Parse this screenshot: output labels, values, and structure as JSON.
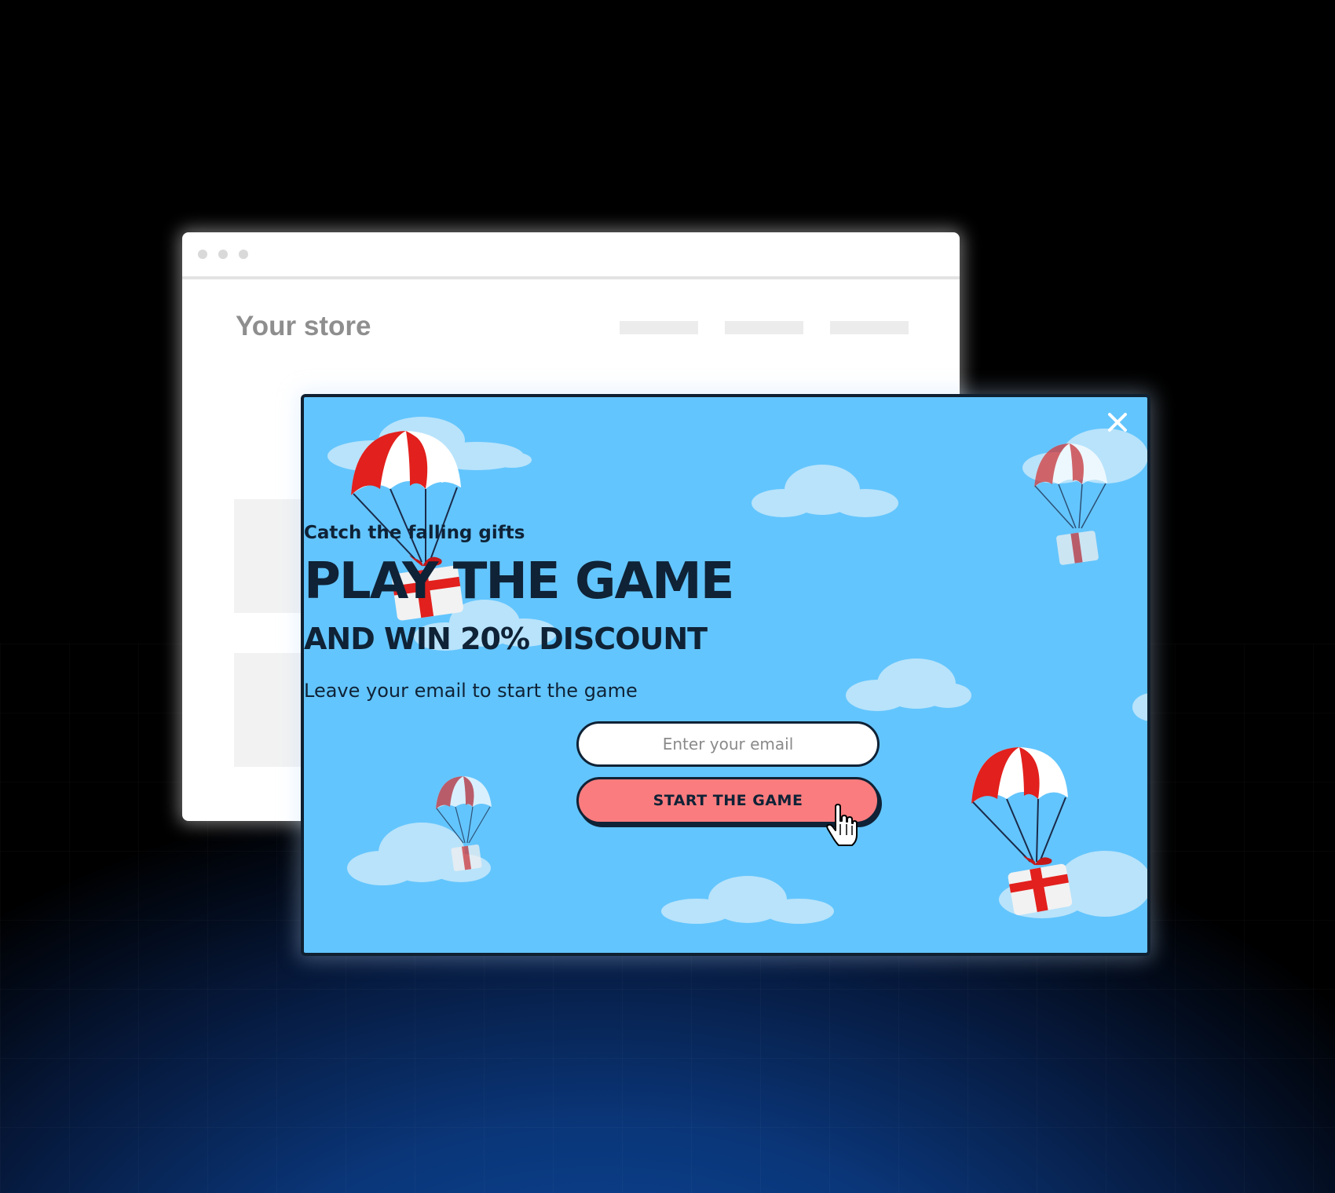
{
  "store": {
    "brand": "Your store"
  },
  "popup": {
    "kicker": "Catch the falling gifts",
    "headline": "PLAY THE GAME",
    "subheadline": "AND WIN 20% DISCOUNT",
    "instruction": "Leave your email to start the game",
    "email_placeholder": "Enter your email",
    "start_label": "START THE GAME",
    "close_icon": "close-icon"
  },
  "colors": {
    "popup_background": "#63c5fd",
    "button_background": "#fa7c7e",
    "text_dark": "#0f2236"
  }
}
